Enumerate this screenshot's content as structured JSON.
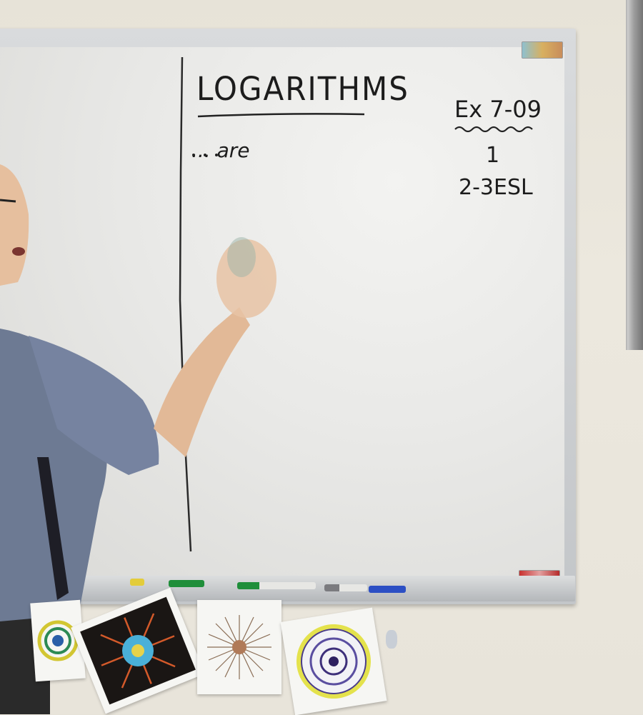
{
  "whiteboard": {
    "heading": "LOGARITHMS",
    "left_prompt": "... are",
    "exercise": {
      "title": "Ex 7-09",
      "line1": "1",
      "line2": "2-3ESL"
    }
  },
  "scene": {
    "wall_color": "#e7e3d8",
    "board_color": "#ececea",
    "ink_color": "#1c1c1c",
    "shirt_color": "#6d7a93",
    "posters": [
      "yellow-green-mandala",
      "dark-flower-mandala",
      "sepia-starburst",
      "blue-yellow-mandala"
    ],
    "markers": [
      "yellow",
      "green",
      "green",
      "grey",
      "blue"
    ]
  }
}
